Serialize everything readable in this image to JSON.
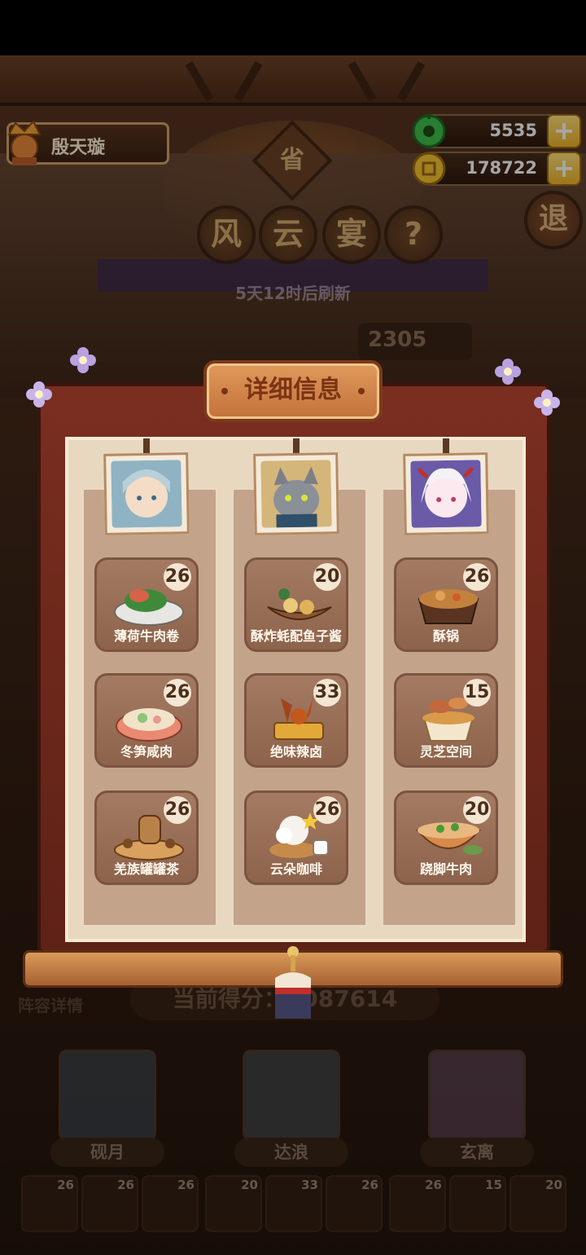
{
  "player": {
    "name": "殷天璇"
  },
  "currency": {
    "jade": "5535",
    "coins": "178722",
    "plus": "+"
  },
  "event": {
    "badge": "省",
    "title_chars": [
      "风",
      "云",
      "宴"
    ],
    "help": "?",
    "exit": "退",
    "refresh": "5天12时后刷新",
    "score_tag": "2305"
  },
  "panel": {
    "title": "详细信息",
    "columns": [
      {
        "hero": "砚月",
        "dishes": [
          {
            "name": "薄荷牛肉卷",
            "level": "26"
          },
          {
            "name": "冬笋咸肉",
            "level": "26"
          },
          {
            "name": "羌族罐罐茶",
            "level": "26"
          }
        ]
      },
      {
        "hero": "达浪",
        "dishes": [
          {
            "name": "酥炸蚝配鱼子酱",
            "level": "20"
          },
          {
            "name": "绝味辣卤",
            "level": "33"
          },
          {
            "name": "云朵咖啡",
            "level": "26"
          }
        ]
      },
      {
        "hero": "玄离",
        "dishes": [
          {
            "name": "酥锅",
            "level": "26"
          },
          {
            "name": "灵芝空间",
            "level": "15"
          },
          {
            "name": "跷脚牛肉",
            "level": "20"
          }
        ]
      }
    ]
  },
  "background": {
    "lineup_label": "阵容详情",
    "current_score": "当前得分：1087614",
    "heroes": [
      "砚月",
      "达浪",
      "玄离"
    ],
    "slots": [
      "26",
      "26",
      "26",
      "20",
      "33",
      "26",
      "26",
      "15",
      "20"
    ]
  },
  "colors": {
    "panel": "#6e281b",
    "parchment": "#e9d8c0",
    "card": "#9a6f57",
    "gold": "#f2b52a"
  }
}
